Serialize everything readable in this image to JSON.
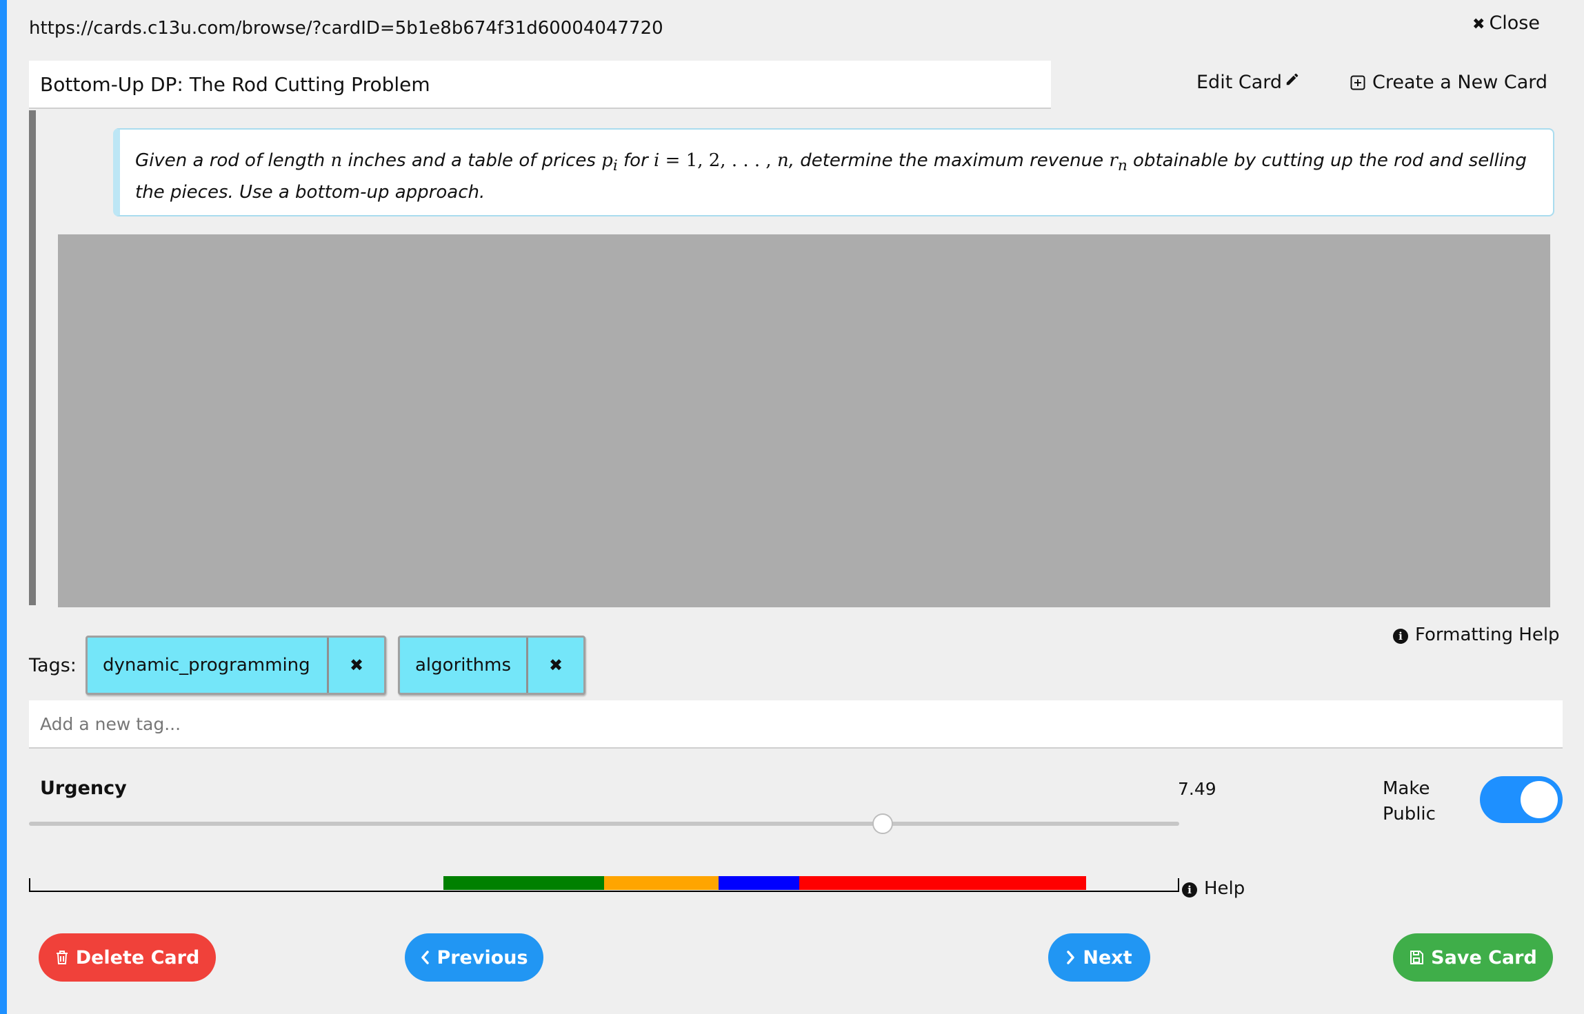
{
  "url": "https://cards.c13u.com/browse/?cardID=5b1e8b674f31d60004047720",
  "close_label": "Close",
  "title": "Bottom-Up DP: The Rod Cutting Problem",
  "edit_label": "Edit Card",
  "new_card_label": "Create a New Card",
  "prompt": {
    "t1": "Given a rod of length ",
    "m_n": "n",
    "t2": " inches and a table of prices ",
    "m_p": "p",
    "m_i_sub": "i",
    "t3": " for ",
    "m_i": "i",
    "m_eq": " = 1, 2, . . . , ",
    "m_n2": "n",
    "t4": ", determine the maximum revenue ",
    "m_r": "r",
    "m_r_sub": "n",
    "t5": " obtainable by cutting up the rod and selling the pieces. Use a bottom-up approach."
  },
  "formatting_help_label": "Formatting Help",
  "tags_label": "Tags:",
  "tags": [
    {
      "label": "dynamic_programming"
    },
    {
      "label": "algorithms"
    }
  ],
  "tag_input_placeholder": "Add a new tag...",
  "urgency": {
    "label": "Urgency",
    "value": "7.49",
    "slider_fraction": 0.742
  },
  "make_public_label_1": "Make",
  "make_public_label_2": "Public",
  "make_public_on": true,
  "help_label": "Help",
  "timeline_colors": [
    "#008000",
    "#ffa500",
    "#0000ff",
    "#ff0000"
  ],
  "buttons": {
    "delete": "Delete Card",
    "previous": "Previous",
    "next": "Next",
    "save": "Save Card"
  },
  "colors": {
    "accent_blue": "#2196f3",
    "delete_red": "#f0413a",
    "save_green": "#3fae49",
    "tag_cyan": "#74e6f9"
  }
}
